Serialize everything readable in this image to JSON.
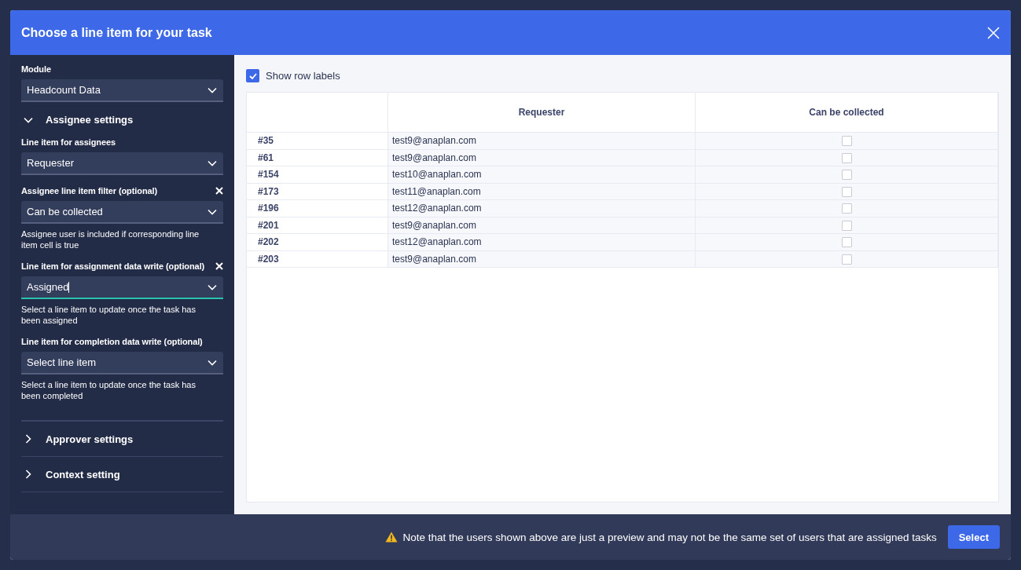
{
  "dialog": {
    "title": "Choose a line item for your task"
  },
  "sidebar": {
    "module": {
      "label": "Module",
      "value": "Headcount Data"
    },
    "sections": [
      {
        "title": "Assignee settings",
        "expanded": true,
        "fields": [
          {
            "label": "Line item for assignees",
            "value": "Requester",
            "clearable": false,
            "focused": false
          },
          {
            "label": "Assignee line item filter (optional)",
            "value": "Can be collected",
            "clearable": true,
            "focused": false,
            "help": "Assignee user is included if corresponding line item cell is true"
          },
          {
            "label": "Line item for assignment data write (optional)",
            "value": "Assigned",
            "clearable": true,
            "focused": true,
            "help": "Select a line item to update once the task has been assigned"
          },
          {
            "label": "Line item for completion data write (optional)",
            "placeholder": "Select line item",
            "clearable": false,
            "focused": false,
            "help": "Select a line item to update once the task has been completed"
          }
        ]
      },
      {
        "title": "Approver settings",
        "expanded": false
      },
      {
        "title": "Context setting",
        "expanded": false
      }
    ]
  },
  "preview": {
    "show_row_labels": {
      "label": "Show row labels",
      "checked": true
    },
    "table": {
      "columns": [
        {
          "label": "Requester"
        },
        {
          "label": "Can be collected"
        }
      ],
      "rows": [
        {
          "label": "#35",
          "requester": "test9@anaplan.com",
          "collected": false
        },
        {
          "label": "#61",
          "requester": "test9@anaplan.com",
          "collected": false
        },
        {
          "label": "#154",
          "requester": "test10@anaplan.com",
          "collected": false
        },
        {
          "label": "#173",
          "requester": "test11@anaplan.com",
          "collected": false
        },
        {
          "label": "#196",
          "requester": "test12@anaplan.com",
          "collected": false
        },
        {
          "label": "#201",
          "requester": "test9@anaplan.com",
          "collected": false
        },
        {
          "label": "#202",
          "requester": "test12@anaplan.com",
          "collected": false
        },
        {
          "label": "#203",
          "requester": "test9@anaplan.com",
          "collected": false
        }
      ]
    }
  },
  "footer": {
    "note": "Note that the users shown above are just a preview and may not be the same set of users that are assigned tasks",
    "button": "Select"
  }
}
